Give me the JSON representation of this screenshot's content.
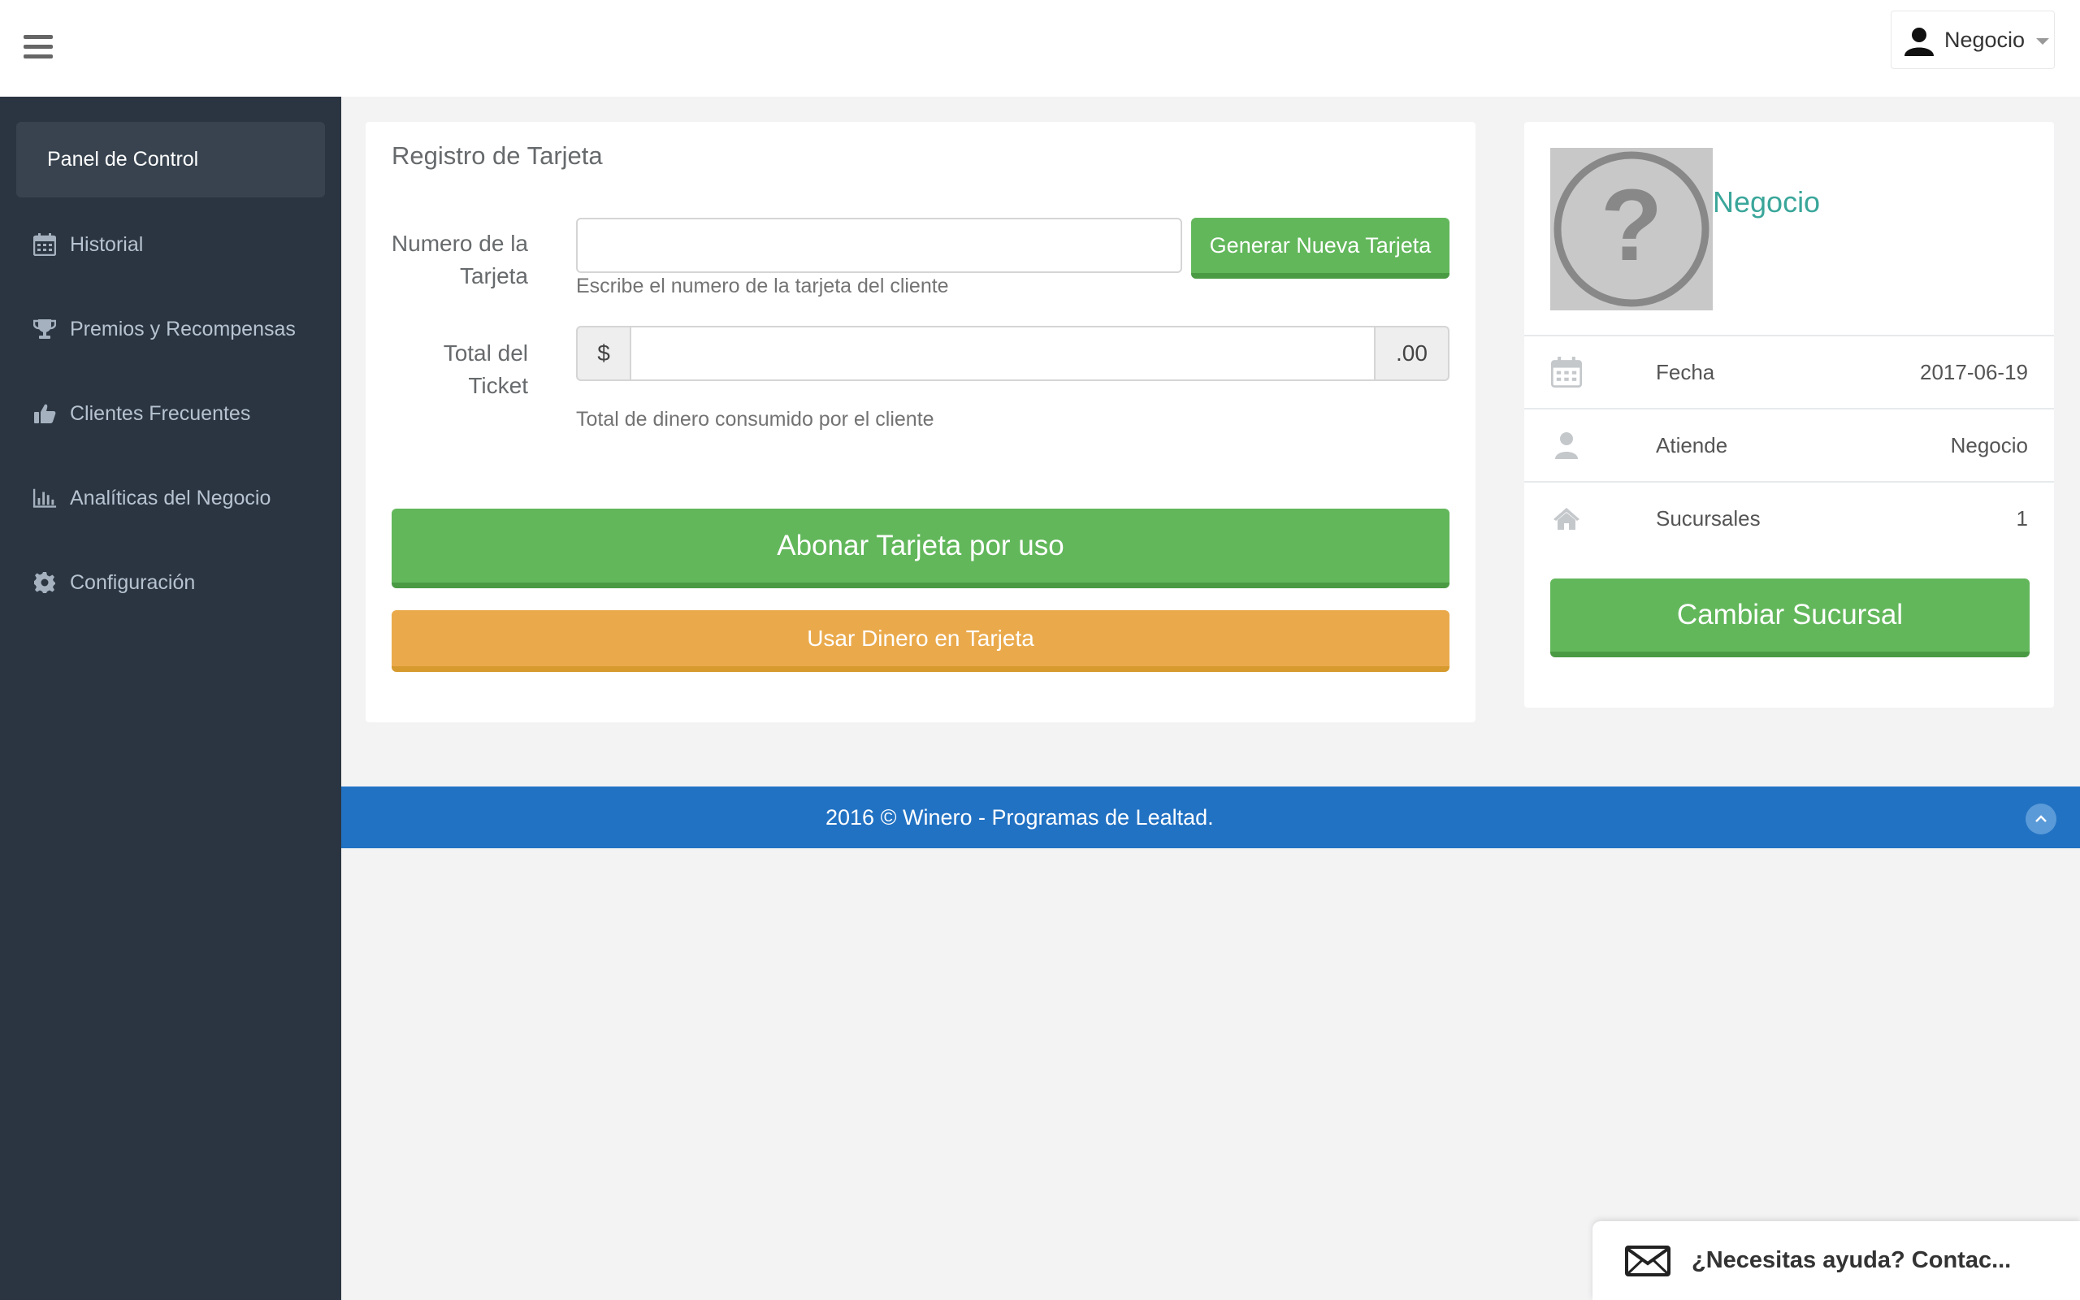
{
  "header": {
    "user_name": "Negocio"
  },
  "sidebar": {
    "active_label": "Panel de Control",
    "items": [
      {
        "label": "Historial",
        "icon": "calendar-icon"
      },
      {
        "label": "Premios y Recompensas",
        "icon": "trophy-icon"
      },
      {
        "label": "Clientes Frecuentes",
        "icon": "thumbs-up-icon"
      },
      {
        "label": "Analíticas del Negocio",
        "icon": "bar-chart-icon"
      },
      {
        "label": "Configuración",
        "icon": "gear-icon"
      }
    ]
  },
  "card_form": {
    "title": "Registro de Tarjeta",
    "card_number_label": "Numero de la Tarjeta",
    "card_number_value": "",
    "card_number_help": "Escribe el numero de la tarjeta del cliente",
    "generate_button": "Generar Nueva Tarjeta",
    "ticket_label": "Total del Ticket",
    "currency_prefix": "$",
    "decimal_suffix": ".00",
    "ticket_value": "",
    "ticket_help": "Total de dinero consumido por el cliente",
    "credit_button": "Abonar Tarjeta por uso",
    "use_money_button": "Usar Dinero en Tarjeta"
  },
  "profile": {
    "name": "Negocio",
    "rows": [
      {
        "label": "Fecha",
        "value": "2017-06-19",
        "icon": "calendar-icon"
      },
      {
        "label": "Atiende",
        "value": "Negocio",
        "icon": "user-icon"
      },
      {
        "label": "Sucursales",
        "value": "1",
        "icon": "home-icon"
      }
    ],
    "change_branch_button": "Cambiar Sucursal"
  },
  "footer": {
    "text": "2016 © Winero - Programas de Lealtad."
  },
  "help_widget": {
    "text": "¿Necesitas ayuda? Contac..."
  },
  "colors": {
    "sidebar_bg": "#2b3542",
    "green": "#62b75b",
    "orange": "#eaaa4c",
    "footer_blue": "#2272c3",
    "teal_name": "#3aa69a"
  }
}
